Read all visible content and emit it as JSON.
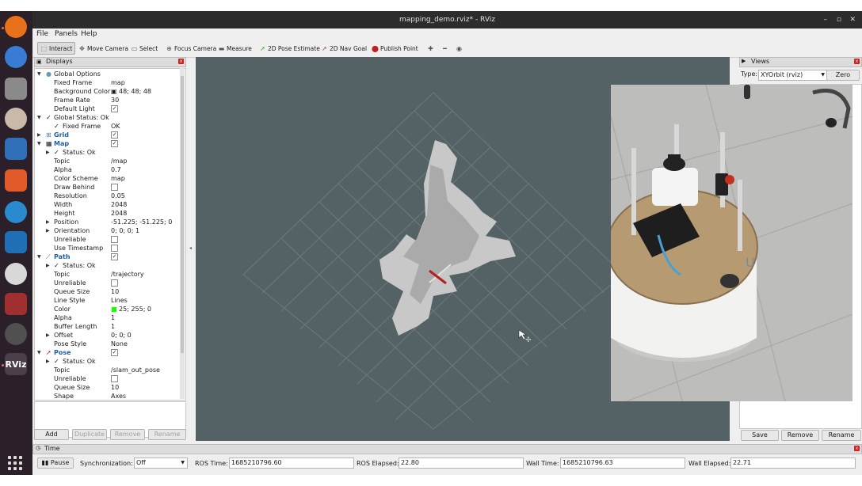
{
  "window": {
    "title": "mapping_demo.rviz* - RViz"
  },
  "menu": [
    "File",
    "Panels",
    "Help"
  ],
  "toolbar": {
    "tools": [
      "Interact",
      "Move Camera",
      "Select",
      "Focus Camera",
      "Measure",
      "2D Pose Estimate",
      "2D Nav Goal",
      "Publish Point"
    ]
  },
  "displays": {
    "title": "Displays",
    "rows": [
      {
        "name": "Global Options",
        "value": "",
        "check": ""
      },
      {
        "name": "Fixed Frame",
        "value": "map",
        "check": ""
      },
      {
        "name": "Background Color",
        "value": "48; 48; 48",
        "check": ""
      },
      {
        "name": "Frame Rate",
        "value": "30",
        "check": ""
      },
      {
        "name": "Default Light",
        "value": "",
        "check": "✓"
      },
      {
        "name": "Global Status: Ok",
        "value": "",
        "check": ""
      },
      {
        "name": "Fixed Frame",
        "value": "OK",
        "check": ""
      },
      {
        "name": "Grid",
        "value": "",
        "check": "✓"
      },
      {
        "name": "Map",
        "value": "",
        "check": "✓"
      },
      {
        "name": "Status: Ok",
        "value": "",
        "check": ""
      },
      {
        "name": "Topic",
        "value": "/map",
        "check": ""
      },
      {
        "name": "Alpha",
        "value": "0.7",
        "check": ""
      },
      {
        "name": "Color Scheme",
        "value": "map",
        "check": ""
      },
      {
        "name": "Draw Behind",
        "value": "",
        "check": " "
      },
      {
        "name": "Resolution",
        "value": "0.05",
        "check": ""
      },
      {
        "name": "Width",
        "value": "2048",
        "check": ""
      },
      {
        "name": "Height",
        "value": "2048",
        "check": ""
      },
      {
        "name": "Position",
        "value": "-51.225; -51.225; 0",
        "check": ""
      },
      {
        "name": "Orientation",
        "value": "0; 0; 0; 1",
        "check": ""
      },
      {
        "name": "Unreliable",
        "value": "",
        "check": " "
      },
      {
        "name": "Use Timestamp",
        "value": "",
        "check": " "
      },
      {
        "name": "Path",
        "value": "",
        "check": "✓"
      },
      {
        "name": "Status: Ok",
        "value": "",
        "check": ""
      },
      {
        "name": "Topic",
        "value": "/trajectory",
        "check": ""
      },
      {
        "name": "Unreliable",
        "value": "",
        "check": " "
      },
      {
        "name": "Queue Size",
        "value": "10",
        "check": ""
      },
      {
        "name": "Line Style",
        "value": "Lines",
        "check": ""
      },
      {
        "name": "Color",
        "value": "25; 255; 0",
        "check": ""
      },
      {
        "name": "Alpha",
        "value": "1",
        "check": ""
      },
      {
        "name": "Buffer Length",
        "value": "1",
        "check": ""
      },
      {
        "name": "Offset",
        "value": "0; 0; 0",
        "check": ""
      },
      {
        "name": "Pose Style",
        "value": "None",
        "check": ""
      },
      {
        "name": "Pose",
        "value": "",
        "check": "✓"
      },
      {
        "name": "Status: Ok",
        "value": "",
        "check": ""
      },
      {
        "name": "Topic",
        "value": "/slam_out_pose",
        "check": ""
      },
      {
        "name": "Unreliable",
        "value": "",
        "check": " "
      },
      {
        "name": "Queue Size",
        "value": "10",
        "check": ""
      },
      {
        "name": "Shape",
        "value": "Axes",
        "check": ""
      }
    ],
    "buttons": {
      "add": "Add",
      "duplicate": "Duplicate",
      "remove": "Remove",
      "rename": "Rename"
    }
  },
  "views": {
    "title": "Views",
    "type_label": "Type:",
    "type_value": "XYOrbit (rviz)",
    "zero": "Zero",
    "save": "Save",
    "remove": "Remove",
    "rename": "Rename"
  },
  "time": {
    "title": "Time",
    "pause": "Pause",
    "sync_label": "Synchronization:",
    "sync_value": "Off",
    "ros_time_label": "ROS Time:",
    "ros_time": "1685210796.60",
    "ros_elapsed_label": "ROS Elapsed:",
    "ros_elapsed": "22.80",
    "wall_time_label": "Wall Time:",
    "wall_time": "1685210796.63",
    "wall_elapsed_label": "Wall Elapsed:",
    "wall_elapsed": "22.71"
  }
}
